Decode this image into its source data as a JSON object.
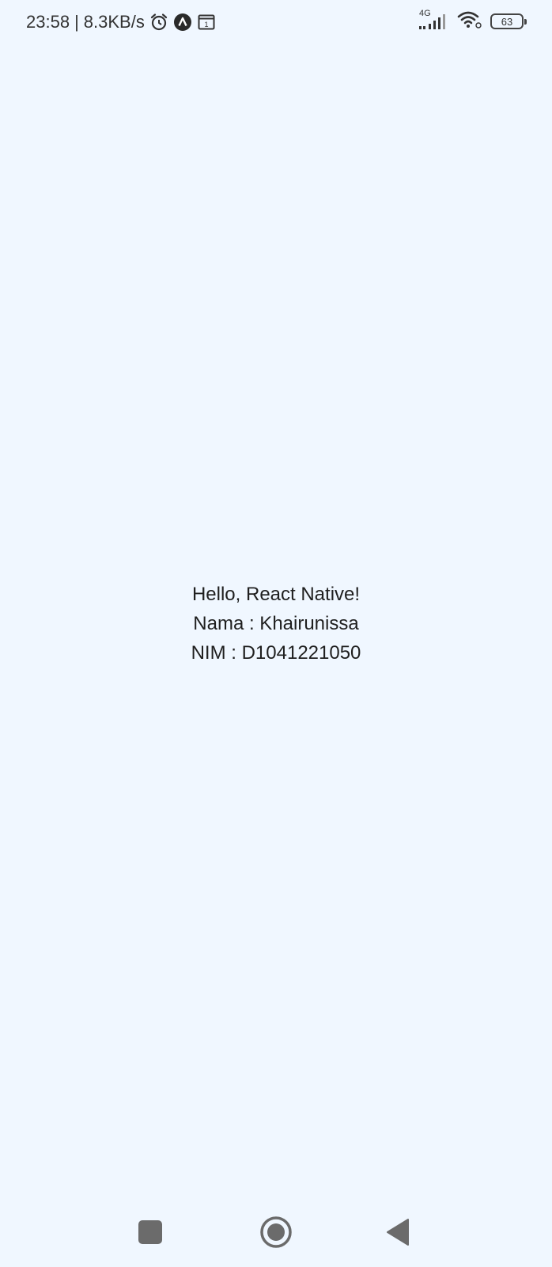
{
  "status_bar": {
    "time": "23:58",
    "separator": "|",
    "net_speed": "8.3KB/s",
    "alarm_icon": "alarm-clock-icon",
    "app_icon": "a-circle-icon",
    "calendar_icon": "calendar-icon",
    "calendar_day": "1",
    "network_type": "4G",
    "signal_icon": "cellular-signal-icon",
    "wifi_icon": "wifi-icon",
    "battery_level": "63"
  },
  "main": {
    "greeting": "Hello, React Native!",
    "name_line": "Nama : Khairunissa",
    "nim_line": "NIM : D1041221050"
  },
  "nav_bar": {
    "recents_icon": "square-recents-icon",
    "home_icon": "circle-home-icon",
    "back_icon": "triangle-back-icon"
  },
  "colors": {
    "background": "#f0f7ff",
    "text": "#1f1f1f",
    "nav_icon": "#6b6b6b"
  }
}
